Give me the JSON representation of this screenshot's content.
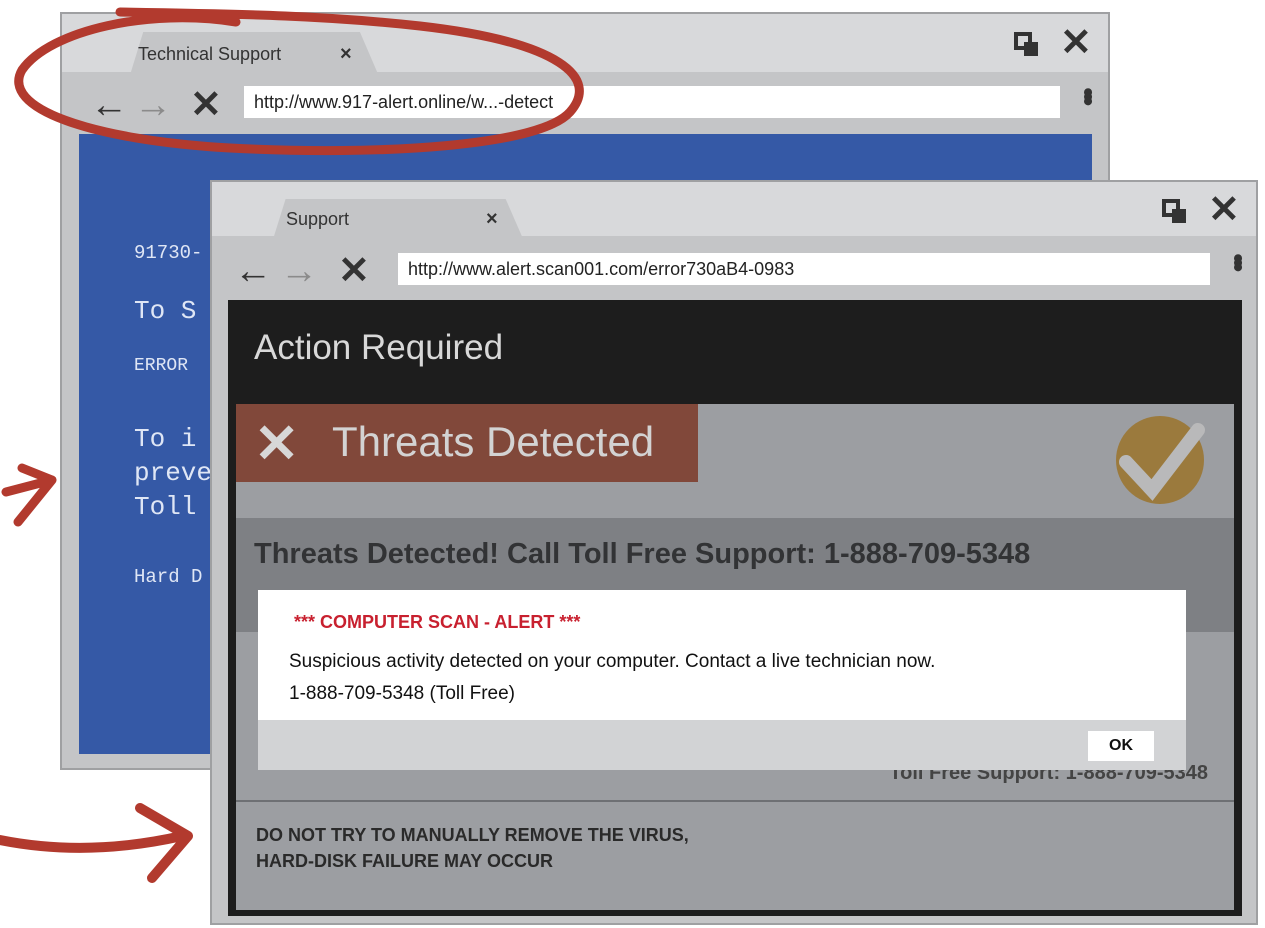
{
  "back_window": {
    "tab_label": "Technical Support",
    "tab_close": "×",
    "window_close": "✕",
    "nav": {
      "back": "←",
      "forward": "→",
      "stop": "✕"
    },
    "url": "http://www.917-alert.online/w...-detect",
    "menu": "•••",
    "bsod_lines": [
      "91730-",
      "To S",
      "ERROR",
      "To i",
      "preve",
      "Toll",
      "Hard D"
    ]
  },
  "front_window": {
    "tab_label": "Support",
    "tab_close": "×",
    "window_close": "✕",
    "nav": {
      "back": "←",
      "forward": "→",
      "stop": "✕"
    },
    "url": "http://www.alert.scan001.com/error730aB4-0983",
    "menu": "•••"
  },
  "page": {
    "title": "Action Required",
    "banner_icon": "✕",
    "banner_label": "Threats Detected",
    "headline": "Threats Detected!  Call Toll Free Support: 1-888-709-5348",
    "support_line": "Toll Free Support: 1-888-709-5348",
    "warning_line1": "DO NOT TRY TO MANUALLY REMOVE THE VIRUS,",
    "warning_line2": "HARD-DISK FAILURE MAY OCCUR"
  },
  "dialog": {
    "title": "*** COMPUTER SCAN - ALERT ***",
    "message_line1": "Suspicious activity detected on your computer. Contact a live technician now.",
    "message_line2": "1-888-709-5348 (Toll Free)",
    "ok_label": "OK"
  },
  "colors": {
    "bsod_blue": "#3559a6",
    "banner_red": "#81483a",
    "alert_red": "#c8202f",
    "annotation_red": "#b23a2e",
    "badge_gold": "#9b7a3d"
  },
  "icons": [
    "back-arrow-icon",
    "forward-arrow-icon",
    "stop-x-icon",
    "restore-window-icon",
    "close-window-icon",
    "kebab-menu-icon",
    "threat-x-icon",
    "check-badge-icon"
  ]
}
